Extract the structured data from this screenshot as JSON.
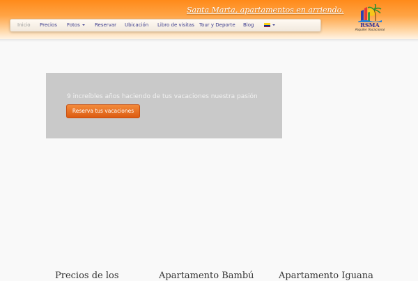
{
  "header": {
    "tagline": "Santa Marta, apartamentos en arriendo.",
    "logo": {
      "name": "RSMA",
      "subtitle": "Alquiler Vacacional"
    }
  },
  "nav": {
    "items": [
      {
        "label": "Inicio",
        "active": true
      },
      {
        "label": "Precios",
        "active": false
      },
      {
        "label": "Fotos",
        "active": false,
        "dropdown": true
      },
      {
        "label": "Reservar",
        "active": false
      },
      {
        "label": "Ubicación",
        "active": false
      },
      {
        "label": "Libro de visitas",
        "active": false
      },
      {
        "label": "Tour y Deporte",
        "active": false
      },
      {
        "label": "Blog",
        "active": false
      }
    ],
    "language_icon": "colombia-flag-icon",
    "colors": {
      "link": "#3a3a8c",
      "active": "#9a9a9a"
    }
  },
  "hero": {
    "text": "9 increíbles años haciendo de tus vacaciones nuestra pasión",
    "button_label": "Reserva tus vacaciones",
    "button_color": "#e8701f"
  },
  "sections": [
    {
      "title": "Precios de los"
    },
    {
      "title": "Apartamento Bambú"
    },
    {
      "title": "Apartamento Iguana"
    }
  ]
}
